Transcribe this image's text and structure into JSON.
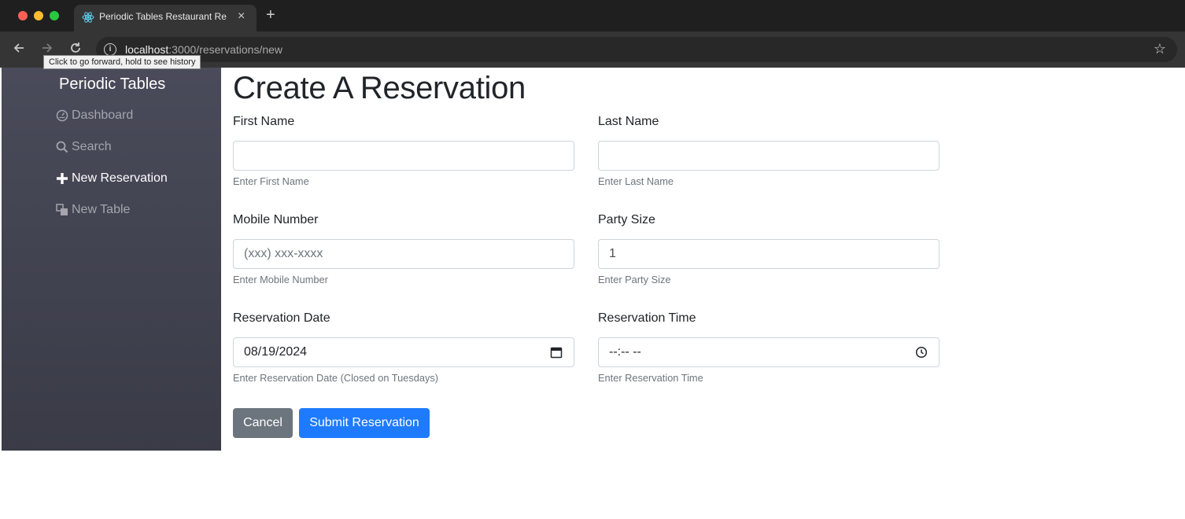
{
  "browser": {
    "tab_title": "Periodic Tables Restaurant Re",
    "tab_close": "×",
    "new_tab": "+",
    "url_host": "localhost",
    "url_path": ":3000/reservations/new",
    "tooltip": "Click to go forward, hold to see history"
  },
  "sidebar": {
    "brand": "Periodic Tables",
    "items": [
      {
        "label": "Dashboard",
        "icon": "dashboard-icon",
        "active": false
      },
      {
        "label": "Search",
        "icon": "search-icon",
        "active": false
      },
      {
        "label": "New Reservation",
        "icon": "plus-icon",
        "active": true
      },
      {
        "label": "New Table",
        "icon": "table-icon",
        "active": false
      }
    ]
  },
  "page": {
    "title": "Create A Reservation"
  },
  "form": {
    "first_name": {
      "label": "First Name",
      "value": "",
      "help": "Enter First Name"
    },
    "last_name": {
      "label": "Last Name",
      "value": "",
      "help": "Enter Last Name"
    },
    "mobile": {
      "label": "Mobile Number",
      "placeholder": "(xxx) xxx-xxxx",
      "help": "Enter Mobile Number"
    },
    "party_size": {
      "label": "Party Size",
      "value": "1",
      "help": "Enter Party Size"
    },
    "date": {
      "label": "Reservation Date",
      "value": "08/19/2024",
      "help": "Enter Reservation Date (Closed on Tuesdays)"
    },
    "time": {
      "label": "Reservation Time",
      "value": "--:-- --",
      "help": "Enter Reservation Time"
    }
  },
  "buttons": {
    "cancel": "Cancel",
    "submit": "Submit Reservation"
  },
  "colors": {
    "sidebar_top": "#4a4b5a",
    "sidebar_bottom": "#3a3b47",
    "primary": "#1e7bff",
    "secondary": "#6c757d"
  }
}
